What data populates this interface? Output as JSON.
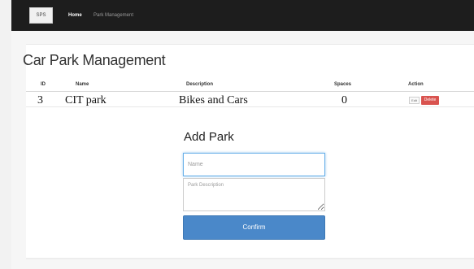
{
  "navbar": {
    "brand": "SPS",
    "links": [
      {
        "label": "Home",
        "active": true
      },
      {
        "label": "Park Management",
        "active": false
      }
    ]
  },
  "page": {
    "title": "Car Park Management"
  },
  "table": {
    "columns": [
      "ID",
      "Name",
      "Description",
      "Spaces",
      "Action"
    ],
    "rows": [
      {
        "id": "3",
        "name": "CIT park",
        "description": "Bikes and Cars",
        "spaces": "0",
        "actions": {
          "edit": "Edit",
          "delete": "Delete"
        }
      }
    ]
  },
  "form": {
    "title": "Add Park",
    "name_placeholder": "Name",
    "description_placeholder": "Park Description",
    "confirm_label": "Confirm"
  },
  "colors": {
    "navbar": "#1d1d1d",
    "delete_button": "#d9534f",
    "confirm_button": "#4a88c9",
    "focus_border": "#66afe9"
  }
}
